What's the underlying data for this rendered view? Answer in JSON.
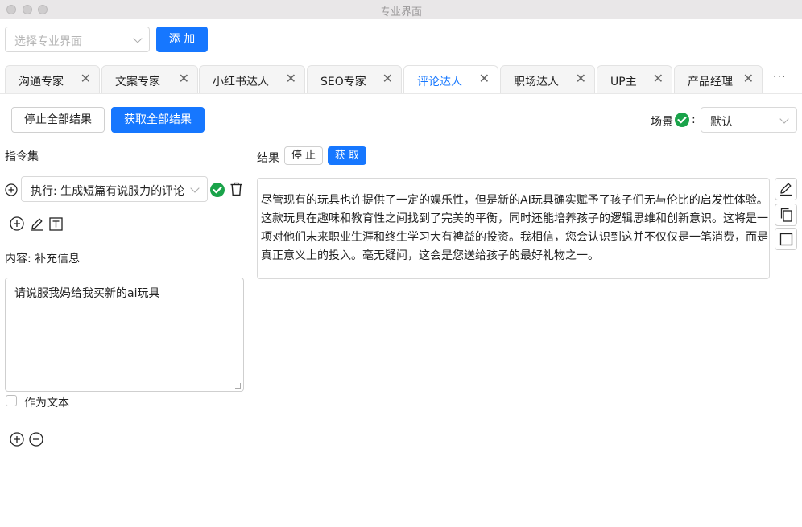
{
  "window": {
    "title": "专业界面"
  },
  "top": {
    "select_placeholder": "选择专业界面",
    "add_label": "添 加"
  },
  "tabs": [
    {
      "label": "沟通专家"
    },
    {
      "label": "文案专家"
    },
    {
      "label": "小红书达人"
    },
    {
      "label": "SEO专家"
    },
    {
      "label": "评论达人",
      "active": true
    },
    {
      "label": "职场达人"
    },
    {
      "label": "UP主"
    },
    {
      "label": "产品经理"
    }
  ],
  "tabs_more": "···",
  "tab_close_glyph": "✕",
  "toolbar": {
    "stop_all_label": "停止全部结果",
    "get_all_label": "获取全部结果",
    "scene_label": "场景",
    "scene_colon": ":",
    "scene_value": "默认"
  },
  "left": {
    "instructions_title": "指令集",
    "command_value": "执行: 生成短篇有说服力的评论",
    "content_label": "内容: 补充信息",
    "content_text": "请说服我妈给我买新的ai玩具",
    "as_text_label": "作为文本"
  },
  "right": {
    "result_label": "结果",
    "stop_label": "停 止",
    "fetch_label": "获 取",
    "result_text": "尽管现有的玩具也许提供了一定的娱乐性，但是新的AI玩具确实赋予了孩子们无与伦比的启发性体验。这款玩具在趣味和教育性之间找到了完美的平衡，同时还能培养孩子的逻辑思维和创新意识。这将是一项对他们未来职业生涯和终生学习大有裨益的投资。我相信，您会认识到这并不仅仅是一笔消费，而是真正意义上的投入。毫无疑问，这会是您送给孩子的最好礼物之一。"
  },
  "colors": {
    "primary": "#1677ff",
    "success": "#1aa34a"
  }
}
